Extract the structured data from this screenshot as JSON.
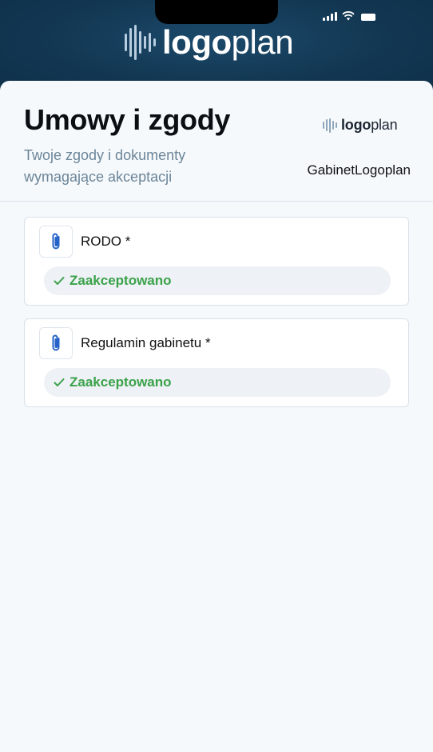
{
  "app": {
    "brand_bold": "logo",
    "brand_light": "plan"
  },
  "page": {
    "title": "Umowy i zgody",
    "subtitle": "Twoje zgody i dokumenty wymagające akceptacji",
    "clinic_name": "GabinetLogoplan"
  },
  "documents": [
    {
      "title": "RODO *",
      "status": "Zaakceptowano",
      "icon": "paperclip-icon"
    },
    {
      "title": "Regulamin gabinetu *",
      "status": "Zaakceptowano",
      "icon": "paperclip-icon"
    }
  ],
  "colors": {
    "header": "#123752",
    "accepted": "#3aa24a",
    "icon_blue": "#2563c9"
  }
}
